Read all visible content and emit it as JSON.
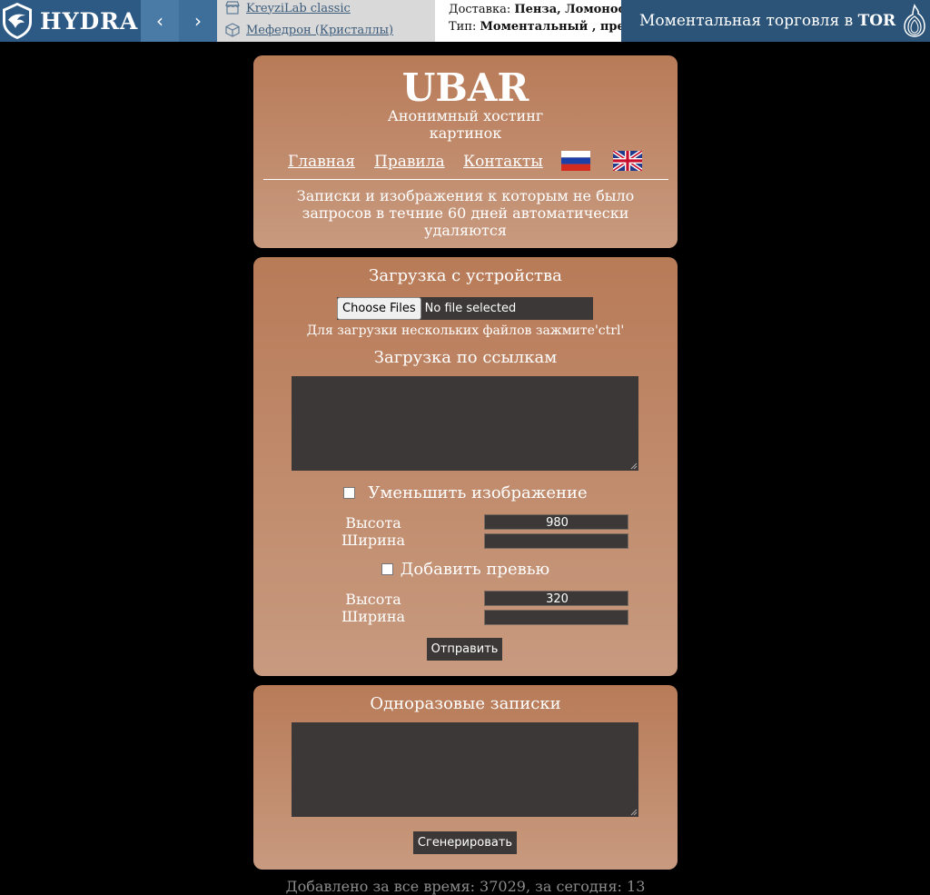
{
  "banner": {
    "logo_text": "HYDRA",
    "nav_prev": "‹",
    "nav_next": "›",
    "shops": [
      "KreyziLab classic",
      "Мефедрон (Кристаллы)"
    ],
    "delivery_label": "Доставка:",
    "delivery_value": "Пенза, Ломоносов",
    "type_label": "Тип:",
    "type_value": "Моментальный , предз",
    "tor_text": "Моментальная торговля в",
    "tor_bold": "TOR"
  },
  "header": {
    "title": "UBAR",
    "subtitle_line1": "Анонимный хостинг",
    "subtitle_line2": "картинок",
    "menu": [
      "Главная",
      "Правила",
      "Контакты"
    ],
    "notice_line1": "Записки и изображения к которым не было",
    "notice_line2": "запросов в течние 60 дней автоматически",
    "notice_line3": "удаляются"
  },
  "upload": {
    "device_heading": "Загрузка с устройства",
    "file_button": "Choose Files",
    "file_status": "No file selected",
    "multi_hint": "Для загрузки нескольких файлов зажмите'ctrl'",
    "links_heading": "Загрузка по ссылкам",
    "shrink_label": "Уменьшить изображение",
    "height_label": "Высота",
    "width_label": "Ширина",
    "shrink_height": "980",
    "shrink_width": "",
    "preview_label": "Добавить превью",
    "preview_height": "320",
    "preview_width": "",
    "submit": "Отправить"
  },
  "notes": {
    "heading": "Одноразовые записки",
    "generate": "Сгенерировать"
  },
  "footer": {
    "stats": "Добавлено за все время: 37029, за сегодня: 13"
  },
  "colors": {
    "panel_top": "#b87b58",
    "panel_bottom": "#c89a7f",
    "field_bg": "#3d3838",
    "banner_blue": "#2d5a85"
  }
}
